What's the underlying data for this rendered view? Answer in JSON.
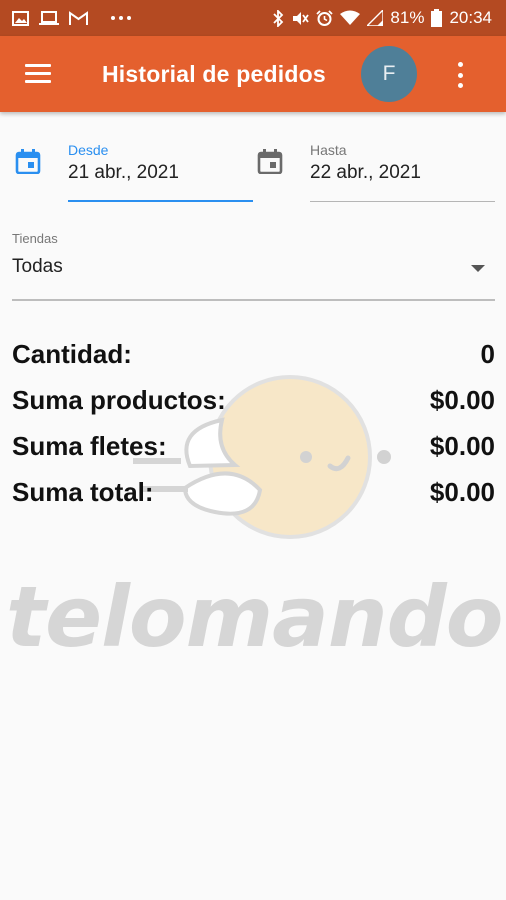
{
  "status_bar": {
    "battery": "81%",
    "time": "20:34",
    "icons": [
      "image-icon",
      "laptop-icon",
      "gmail-icon",
      "more-icon",
      "bluetooth-icon",
      "mute-icon",
      "alarm-icon",
      "wifi-icon",
      "signal-icon",
      "battery-icon"
    ]
  },
  "app_bar": {
    "title": "Historial de pedidos",
    "avatar_initial": "F",
    "bg_color": "#e4602e",
    "status_color": "#b44a22",
    "avatar_color": "#4f7f98"
  },
  "date_from": {
    "label": "Desde",
    "value": "21 abr., 2021",
    "accent": "#2a8ff0"
  },
  "date_to": {
    "label": "Hasta",
    "value": "22 abr., 2021"
  },
  "stores": {
    "label": "Tiendas",
    "value": "Todas"
  },
  "summary": [
    {
      "label": "Cantidad:",
      "value": "0"
    },
    {
      "label": "Suma productos:",
      "value": "$0.00"
    },
    {
      "label": "Suma fletes:",
      "value": "$0.00"
    },
    {
      "label": "Suma total:",
      "value": "$0.00"
    }
  ],
  "watermark": {
    "text": "telomando"
  }
}
